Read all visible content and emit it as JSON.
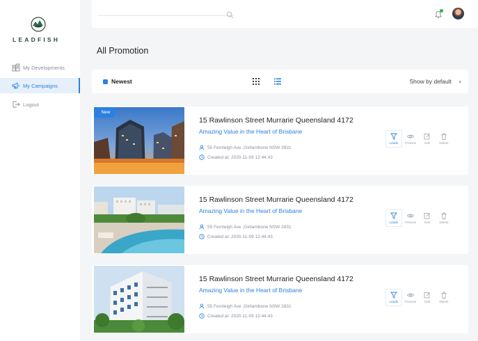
{
  "brand": {
    "logo_text": "LEADFISH"
  },
  "sidebar": {
    "items": [
      {
        "label": "My Developments",
        "icon": "buildings-icon"
      },
      {
        "label": "My Campaigns",
        "icon": "megaphone-icon",
        "active": true
      },
      {
        "label": "Logout",
        "icon": "logout-icon"
      }
    ]
  },
  "header": {
    "search_placeholder": ""
  },
  "page": {
    "title": "All Promotion"
  },
  "filter": {
    "sort_label": "Newest",
    "show_by": "Show by default"
  },
  "colors": {
    "accent": "#2b80e0",
    "status_online": "#2fb344"
  },
  "promotions": [
    {
      "badge": "New",
      "title": "15 Rawlinson Street Murrarie Queensland 4172",
      "subtitle": "Amazing Value in the Heart of Brisbane",
      "address": "55 Fernleigh Ave ,Girilambone NSW 2831",
      "created": "Created at: 2020-11-09 12:44:43",
      "image": "city-towers-sunset"
    },
    {
      "badge": "",
      "title": "15 Rawlinson Street Murrarie Queensland 4172",
      "subtitle": "Amazing Value in the Heart of Brisbane",
      "address": "55 Fernleigh Ave ,Girilambone NSW 2831",
      "created": "Created at: 2020-11-09 12:44:43",
      "image": "resort-pool"
    },
    {
      "badge": "",
      "title": "15 Rawlinson Street Murrarie Queensland 4172",
      "subtitle": "Amazing Value in the Heart of Brisbane",
      "address": "55 Fernleigh Ave ,Girilambone NSW 2831",
      "created": "Created at: 2020-11-09 12:44:43",
      "image": "apartment-block"
    }
  ],
  "actions": {
    "leads": "Leads",
    "preview": "Preview",
    "edit": "Edit",
    "delete": "Delete"
  }
}
